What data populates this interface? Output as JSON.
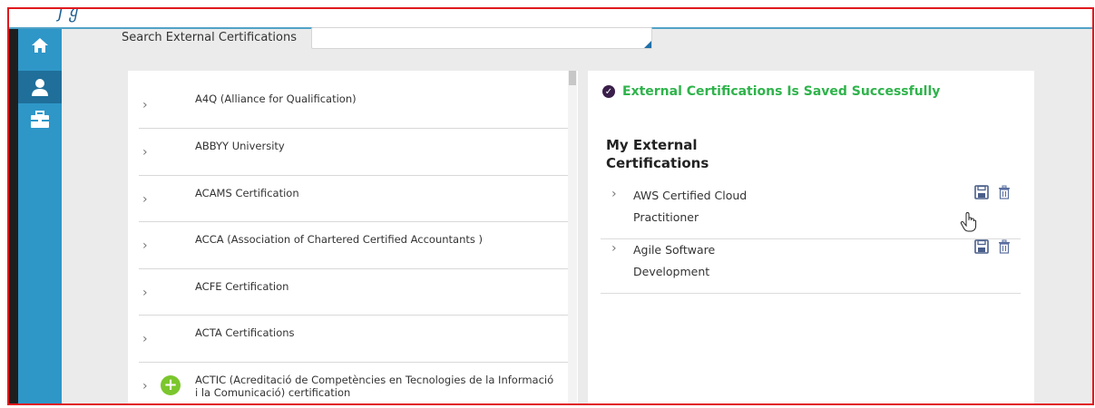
{
  "header": {
    "logo_fragment": "ʃ ყ"
  },
  "sidebar": {
    "items": [
      {
        "icon": "home-icon"
      },
      {
        "icon": "user-icon",
        "active": true
      },
      {
        "icon": "toolbox-icon"
      }
    ]
  },
  "search": {
    "label": "Search External Certifications",
    "value": ""
  },
  "certifications": [
    {
      "name": "A4Q (Alliance for Qualification)"
    },
    {
      "name": "ABBYY University"
    },
    {
      "name": "ACAMS Certification"
    },
    {
      "name": "ACCA (Association of Chartered Certified Accountants )"
    },
    {
      "name": "ACFE Certification"
    },
    {
      "name": "ACTA Certifications"
    },
    {
      "name": "ACTIC (Acreditació de Competències en Tecnologies de la Informació i la Comunicació) certification",
      "add": true
    }
  ],
  "status": {
    "message": "External Certifications Is Saved Successfully",
    "color": "#2fb34b"
  },
  "my_certs": {
    "title": "My External Certifications",
    "items": [
      {
        "name": "AWS Certified Cloud Practitioner"
      },
      {
        "name": "Agile Software Development"
      }
    ]
  },
  "colors": {
    "sidebar": "#2e97c8",
    "sidebar_active": "#1f6f9a",
    "accent": "#1e6fa8",
    "add_button": "#7bc62d",
    "frame_border": "#e0191d"
  }
}
